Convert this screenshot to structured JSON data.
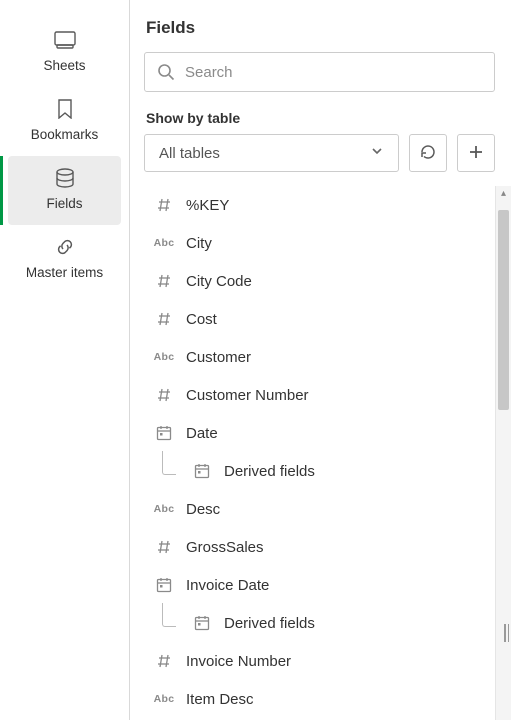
{
  "sidebar": {
    "items": [
      {
        "label": "Sheets"
      },
      {
        "label": "Bookmarks"
      },
      {
        "label": "Fields"
      },
      {
        "label": "Master items"
      }
    ]
  },
  "panel": {
    "title": "Fields",
    "search_placeholder": "Search",
    "section_label": "Show by table",
    "table_select": "All tables"
  },
  "fields": [
    {
      "type": "num",
      "label": "%KEY"
    },
    {
      "type": "abc",
      "label": "City"
    },
    {
      "type": "num",
      "label": "City Code"
    },
    {
      "type": "num",
      "label": "Cost"
    },
    {
      "type": "abc",
      "label": "Customer"
    },
    {
      "type": "num",
      "label": "Customer Number"
    },
    {
      "type": "date",
      "label": "Date"
    },
    {
      "type": "date",
      "label": "Derived fields",
      "child": true
    },
    {
      "type": "abc",
      "label": "Desc"
    },
    {
      "type": "num",
      "label": "GrossSales"
    },
    {
      "type": "date",
      "label": "Invoice Date"
    },
    {
      "type": "date",
      "label": "Derived fields",
      "child": true
    },
    {
      "type": "num",
      "label": "Invoice Number"
    },
    {
      "type": "abc",
      "label": "Item Desc"
    }
  ]
}
